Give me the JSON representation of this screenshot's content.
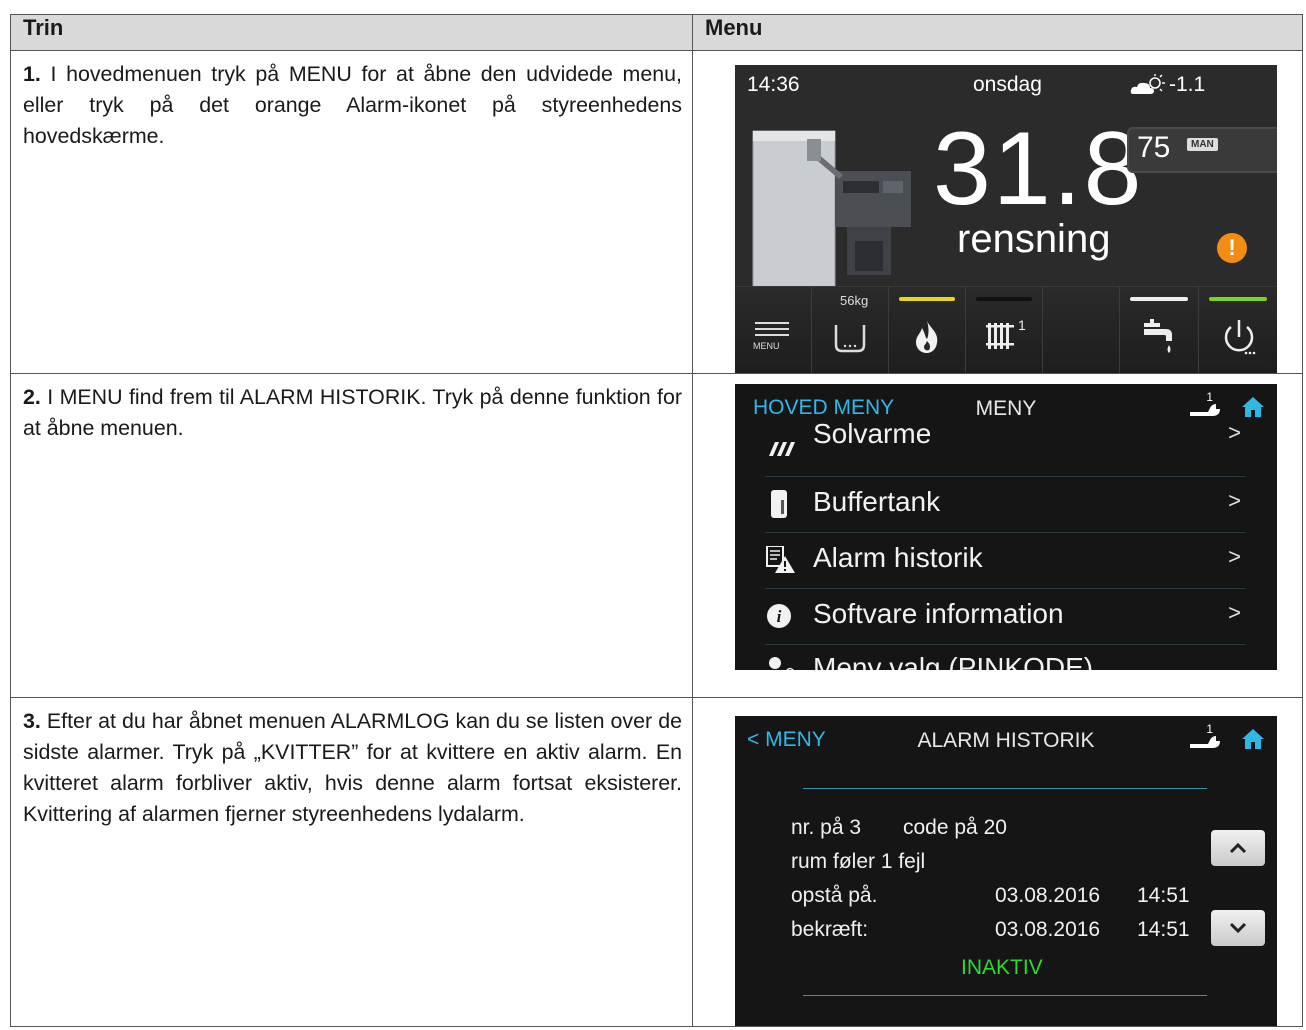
{
  "table": {
    "header_step": "Trin",
    "header_menu": "Menu"
  },
  "steps": [
    {
      "num": "1.",
      "text": " I hovedmenuen tryk på MENU for at åbne den udvidede menu, eller tryk på det orange Alarm-ikonet på styreenhedens hovedskærme."
    },
    {
      "num": "2.",
      "text": " I MENU find frem til ALARM HISTORIK. Tryk på denne funktion for at åbne menuen."
    },
    {
      "num": "3.",
      "text": " Efter at du har åbnet menuen ALARMLOG kan du se listen over de sidste alarmer. Tryk på „KVITTER” for at kvittere en aktiv alarm. En kvitteret alarm forbliver aktiv, hvis denne alarm fortsat eksisterer. Kvittering af alarmen fjerner styreenhedens lydalarm."
    }
  ],
  "screen1": {
    "time": "14:36",
    "day": "onsdag",
    "outdoor_temp": "-1.1",
    "boiler_temp": "31.8",
    "status": "rensning",
    "setpoint": "75",
    "mode_badge": "MAN",
    "alarm_icon": "alarm-exclamation-icon",
    "alarm_color": "#f28c13",
    "menu_label": "MENU",
    "fuel_level": "56kg",
    "circuit_index": "1",
    "indicator_colors": {
      "burner": "#e8d81a",
      "heating": "#111111",
      "hot_water": "#eeeeee",
      "power": "#7ed321"
    }
  },
  "screen2": {
    "left_title": "HOVED MENY",
    "center_title": "MENY",
    "badge": "1",
    "items": [
      {
        "label": "Solvarme",
        "arrow": ">",
        "icon": "solar-icon"
      },
      {
        "label": "Buffertank",
        "arrow": ">",
        "icon": "buffer-tank-icon"
      },
      {
        "label": "Alarm historik",
        "arrow": ">",
        "icon": "alarm-history-icon"
      },
      {
        "label": "Softvare information",
        "arrow": ">",
        "icon": "info-icon"
      },
      {
        "label": "Meny valg (PINKODE)",
        "arrow": "",
        "icon": "user-lock-icon"
      }
    ]
  },
  "screen3": {
    "back_label": "< MENY",
    "title": "ALARM HISTORIK",
    "badge": "1",
    "nr_text": "nr. på 3",
    "code_text": "code på 20",
    "alarm_name": "rum føler 1 fejl",
    "occurred_label": "opstå på.",
    "occurred_date": "03.08.2016",
    "occurred_time": "14:51",
    "confirmed_label": "bekræft:",
    "confirmed_date": "03.08.2016",
    "confirmed_time": "14:51",
    "state": "INAKTIV",
    "state_color": "#2ed82e"
  }
}
